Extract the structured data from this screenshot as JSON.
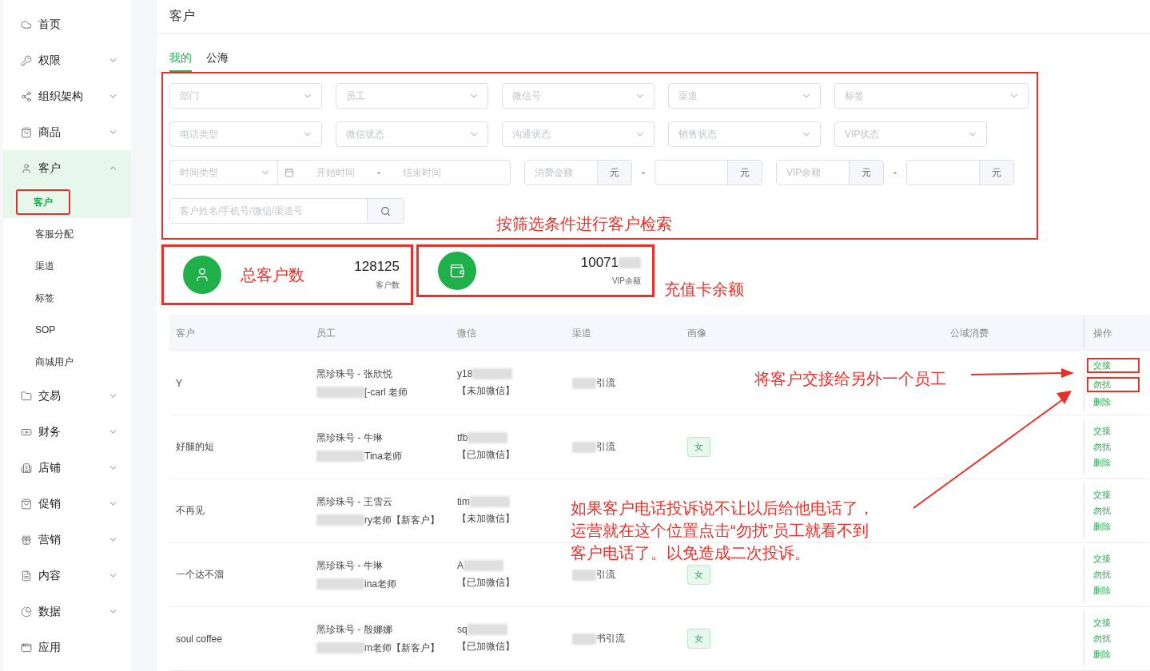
{
  "sidebar": {
    "items": [
      {
        "kind": "link",
        "label": "首页"
      },
      {
        "kind": "group",
        "label": "权限",
        "expanded": false
      },
      {
        "kind": "group",
        "label": "组织架构",
        "expanded": false
      },
      {
        "kind": "group",
        "label": "商品",
        "expanded": false
      },
      {
        "kind": "group",
        "label": "客户",
        "expanded": true,
        "children": [
          {
            "label": "客户",
            "selected": true
          },
          {
            "label": "客服分配",
            "selected": false
          },
          {
            "label": "渠道",
            "selected": false
          },
          {
            "label": "标签",
            "selected": false
          },
          {
            "label": "SOP",
            "selected": false
          },
          {
            "label": "商城用户",
            "selected": false
          }
        ]
      },
      {
        "kind": "group",
        "label": "交易",
        "expanded": false
      },
      {
        "kind": "group",
        "label": "财务",
        "expanded": false
      },
      {
        "kind": "group",
        "label": "店铺",
        "expanded": false
      },
      {
        "kind": "group",
        "label": "促销",
        "expanded": false
      },
      {
        "kind": "group",
        "label": "营销",
        "expanded": false
      },
      {
        "kind": "group",
        "label": "内容",
        "expanded": false
      },
      {
        "kind": "group",
        "label": "数据",
        "expanded": false
      },
      {
        "kind": "link",
        "label": "应用"
      }
    ]
  },
  "page_title": "客户",
  "tabs": [
    {
      "label": "我的",
      "selected": true
    },
    {
      "label": "公海",
      "selected": false
    }
  ],
  "filters": {
    "rows": [
      [
        {
          "kind": "select",
          "placeholder": "部门"
        },
        {
          "kind": "select",
          "placeholder": "员工"
        },
        {
          "kind": "select",
          "placeholder": "微信号"
        },
        {
          "kind": "select",
          "placeholder": "渠道"
        },
        {
          "kind": "wide_select",
          "placeholder": "标签"
        }
      ],
      [
        {
          "kind": "select",
          "placeholder": "电话类型"
        },
        {
          "kind": "select",
          "placeholder": "微信状态"
        },
        {
          "kind": "select",
          "placeholder": "沟通状态"
        },
        {
          "kind": "select",
          "placeholder": "销售状态"
        },
        {
          "kind": "select",
          "placeholder": "VIP状态"
        }
      ],
      [
        {
          "kind": "daterange",
          "type_placeholder": "时间类型",
          "start": "开始时间",
          "separator": "-",
          "end": "结束时间"
        },
        {
          "kind": "amount",
          "placeholder": "消费金额",
          "unit": "元"
        },
        {
          "kind": "dash",
          "text": "-"
        },
        {
          "kind": "amount",
          "unit": "元"
        },
        {
          "kind": "amount",
          "placeholder": "VIP余额",
          "unit": "元"
        },
        {
          "kind": "dash",
          "text": "-"
        },
        {
          "kind": "amount",
          "unit": "元"
        }
      ],
      [
        {
          "kind": "search",
          "placeholder": "客户姓名/手机号/微信/渠道号"
        }
      ]
    ]
  },
  "stats": [
    {
      "value": "128125",
      "label": "客户数",
      "masked": false
    },
    {
      "value": "10071",
      "label": "VIP余额",
      "masked": true
    }
  ],
  "table": {
    "columns": [
      "客户",
      "员工",
      "微信",
      "渠道",
      "画像",
      "公域消费",
      "操作"
    ],
    "rows": [
      {
        "customer": "Y",
        "staff": "黑珍珠号 - 张欣悦",
        "staff_note": "[-carl 老师",
        "wechat": "y18",
        "wechat_status": "【未加微信】",
        "channel": "引流",
        "actions": [
          {
            "label": "交接",
            "highlighted": true
          },
          {
            "label": "勿扰",
            "highlighted": true
          },
          {
            "label": "删除",
            "highlighted": false
          }
        ]
      },
      {
        "customer": "好腿的短",
        "staff": "黑珍珠号 - 牛琳",
        "staff_note": "Tina老师",
        "wechat": "tfb",
        "wechat_status": "【已加微信】",
        "channel": "引流",
        "tag": "女",
        "actions": [
          {
            "label": "交接",
            "highlighted": false
          },
          {
            "label": "勿扰",
            "highlighted": false
          },
          {
            "label": "删除",
            "highlighted": false
          }
        ]
      },
      {
        "customer": "不再见",
        "staff": "黑珍珠号 - 王雪云",
        "staff_note": "ry老师【新客户】",
        "wechat": "tim",
        "wechat_status": "【未加微信】",
        "actions": [
          {
            "label": "交接",
            "highlighted": false
          },
          {
            "label": "勿扰",
            "highlighted": false
          },
          {
            "label": "删除",
            "highlighted": false
          }
        ]
      },
      {
        "customer": "一个达不溜",
        "staff": "黑珍珠号 - 牛琳",
        "staff_note": "ina老师",
        "wechat": "A",
        "wechat_status": "【已加微信】",
        "channel": "引流",
        "tag": "女",
        "actions": [
          {
            "label": "交接",
            "highlighted": false
          },
          {
            "label": "勿扰",
            "highlighted": false
          },
          {
            "label": "删除",
            "highlighted": false
          }
        ]
      },
      {
        "customer": "soul coffee",
        "staff": "黑珍珠号 - 殷娜娜",
        "staff_note": "m老师【新客户】",
        "wechat": "sq",
        "wechat_status": "【已加微信】",
        "channel": "书引流",
        "tag": "女",
        "actions": [
          {
            "label": "交接",
            "highlighted": false
          },
          {
            "label": "勿扰",
            "highlighted": false
          },
          {
            "label": "删除",
            "highlighted": false
          }
        ]
      }
    ]
  },
  "annotations": {
    "filters": "按筛选条件进行客户检索",
    "total": "总客户数",
    "balance": "充值卡余额",
    "handover": "将客户交接给另外一个员工",
    "do_not_disturb": [
      "如果客户电话投诉说不让以后给他电话了，",
      "运营就在这个位置点击“勿扰”员工就看不到",
      "客户电话了。以免造成二次投诉。"
    ]
  }
}
